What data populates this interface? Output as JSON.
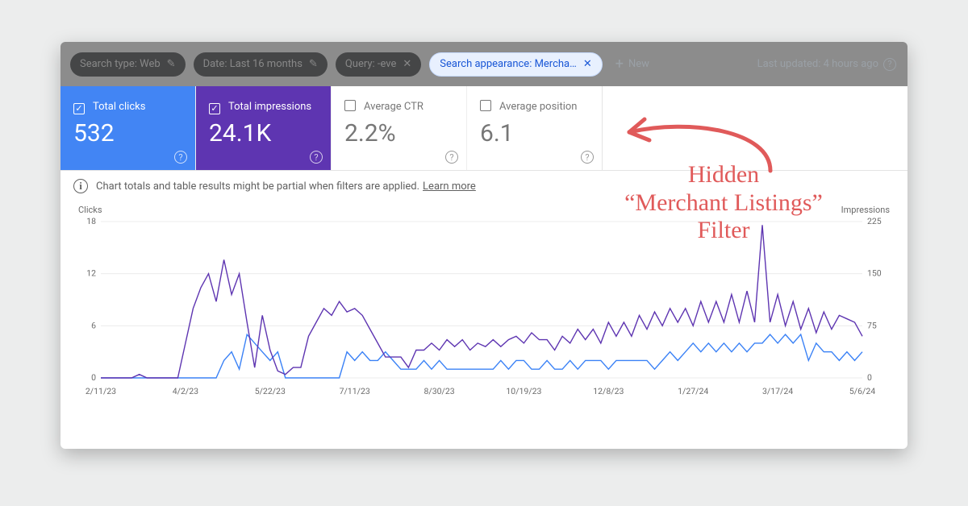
{
  "filters": {
    "search_type": "Search type: Web",
    "date": "Date: Last 16 months",
    "query": "Query: -eve",
    "appearance": "Search appearance: Mercha…",
    "add_new": "New",
    "last_updated": "Last updated: 4 hours ago"
  },
  "metrics": {
    "clicks": {
      "label": "Total clicks",
      "value": "532"
    },
    "impressions": {
      "label": "Total impressions",
      "value": "24.1K"
    },
    "ctr": {
      "label": "Average CTR",
      "value": "2.2%"
    },
    "position": {
      "label": "Average position",
      "value": "6.1"
    }
  },
  "info": {
    "text": "Chart totals and table results might be partial when filters are applied.",
    "learn": "Learn more"
  },
  "axis": {
    "left": "Clicks",
    "right": "Impressions"
  },
  "annotation": {
    "line1": "Hidden",
    "line2": "“Merchant Listings”",
    "line3": "Filter"
  },
  "chart_data": {
    "type": "line",
    "xlabel": "",
    "y_left_label": "Clicks",
    "y_right_label": "Impressions",
    "y_left_lim": [
      0,
      18
    ],
    "y_right_lim": [
      0,
      225
    ],
    "y_left_ticks": [
      0,
      6,
      12,
      18
    ],
    "y_right_ticks": [
      0,
      75,
      150,
      225
    ],
    "categories": [
      "2/11/23",
      "4/2/23",
      "5/22/23",
      "7/11/23",
      "8/30/23",
      "10/19/23",
      "12/8/23",
      "1/27/24",
      "3/17/24",
      "5/6/24"
    ],
    "series": [
      {
        "name": "Clicks",
        "axis": "left",
        "values": [
          0,
          0,
          0,
          0,
          0,
          0,
          0,
          0,
          0,
          0,
          0,
          0,
          0,
          0,
          0,
          0,
          2,
          3,
          1,
          5,
          4,
          3,
          2,
          3,
          0,
          0,
          0,
          0,
          0,
          0,
          0,
          0,
          3,
          2,
          3,
          2,
          2,
          3,
          2,
          1,
          1,
          1,
          2,
          1,
          2,
          1,
          1,
          1,
          1,
          1,
          1,
          1,
          2,
          1,
          2,
          2,
          1,
          1,
          2,
          1,
          1,
          2,
          1,
          2,
          2,
          2,
          1,
          2,
          2,
          2,
          2,
          2,
          1,
          2,
          3,
          2,
          3,
          4,
          3,
          4,
          3,
          4,
          3,
          4,
          3,
          4,
          4,
          5,
          4,
          5,
          4,
          5,
          2,
          4,
          3,
          3,
          2,
          3,
          2,
          3
        ]
      },
      {
        "name": "Impressions",
        "axis": "right",
        "values": [
          0,
          0,
          0,
          0,
          0,
          5,
          0,
          0,
          0,
          0,
          0,
          50,
          100,
          130,
          150,
          110,
          170,
          120,
          150,
          80,
          15,
          90,
          40,
          10,
          5,
          15,
          15,
          60,
          80,
          100,
          90,
          110,
          95,
          100,
          90,
          70,
          50,
          30,
          30,
          30,
          15,
          40,
          40,
          50,
          40,
          55,
          45,
          55,
          40,
          50,
          45,
          55,
          45,
          55,
          60,
          50,
          65,
          55,
          55,
          40,
          60,
          50,
          70,
          55,
          70,
          50,
          80,
          60,
          80,
          60,
          90,
          70,
          95,
          75,
          100,
          80,
          100,
          75,
          110,
          80,
          110,
          80,
          120,
          80,
          125,
          80,
          220,
          80,
          120,
          75,
          110,
          70,
          100,
          65,
          95,
          70,
          90,
          85,
          80,
          60
        ]
      }
    ]
  }
}
